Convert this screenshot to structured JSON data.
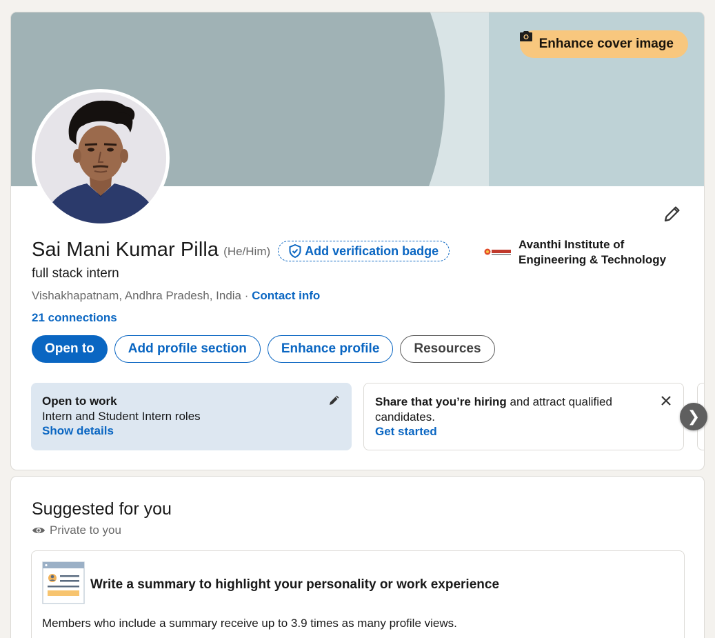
{
  "cover": {
    "enhance_label": "Enhance cover image",
    "icon": "camera-icon"
  },
  "profile": {
    "name": "Sai Mani Kumar Pilla",
    "pronouns": "(He/Him)",
    "verify_label": "Add verification badge",
    "headline": "full stack intern",
    "location": "Vishakhapatnam, Andhra Pradesh, India",
    "separator": " · ",
    "contact_label": "Contact info",
    "connections": "21 connections",
    "school": {
      "name": "Avanthi Institute of Engineering & Technology",
      "logo_text": "AVANTHI"
    }
  },
  "actions": {
    "open_to": "Open to",
    "add_section": "Add profile section",
    "enhance": "Enhance profile",
    "resources": "Resources"
  },
  "tiles": {
    "open_to_work": {
      "title": "Open to work",
      "text": "Intern and Student Intern roles",
      "link": "Show details"
    },
    "hiring": {
      "title": "Share that you’re hiring",
      "text": " and attract qualified candidates.",
      "link": "Get started"
    },
    "next": "❯"
  },
  "suggested": {
    "title": "Suggested for you",
    "private": "Private to you",
    "item": {
      "heading": "Write a summary to highlight your personality or work experience",
      "description": "Members who include a summary receive up to 3.9 times as many profile views."
    }
  },
  "colors": {
    "primary": "#0a66c2",
    "cover_accent": "#f8c77e",
    "open_to_work_bg": "#dde7f1"
  }
}
